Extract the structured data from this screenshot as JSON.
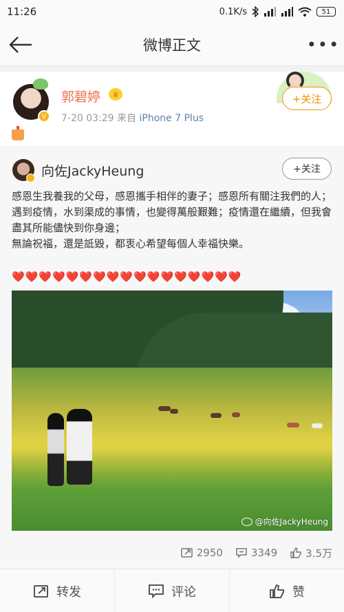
{
  "status_bar": {
    "time": "11:26",
    "network_speed": "0.1K/s",
    "battery": "51"
  },
  "nav": {
    "title": "微博正文"
  },
  "post": {
    "author": "郭碧婷",
    "timestamp": "7-20 03:29",
    "source_prefix": "来自",
    "source": "iPhone 7 Plus",
    "follow_label": "+关注"
  },
  "repost": {
    "author": "向佐JackyHeung",
    "follow_label": "+关注",
    "text_lines": [
      "感恩生我養我的父母，感恩攜手相伴的妻子；感恩所有關注我們的人；",
      "遇到疫情，水到渠成的事情，也變得萬般艱難；疫情還在繼續，但我會盡其所能儘快到你身邊；",
      "無論祝福，還是詆毀，都衷心希望每個人幸福快樂。"
    ],
    "hearts": "❤️❤️❤️❤️❤️❤️❤️❤️❤️❤️❤️❤️❤️❤️❤️❤️❤️",
    "image_watermark": "@向佐JackyHeung",
    "stats": {
      "reposts": "2950",
      "comments": "3349",
      "likes": "3.5万"
    }
  },
  "actions": {
    "repost": "转发",
    "comment": "评论",
    "like": "赞"
  },
  "colors": {
    "accent_orange": "#eb7350",
    "follow_orange": "#f29100",
    "link_blue": "#5b7fae"
  },
  "icons": [
    "back-arrow-icon",
    "more-icon",
    "verified-badge-icon",
    "vip-crown-icon",
    "cake-icon",
    "repost-icon",
    "comment-icon",
    "like-icon",
    "weibo-logo-icon"
  ]
}
